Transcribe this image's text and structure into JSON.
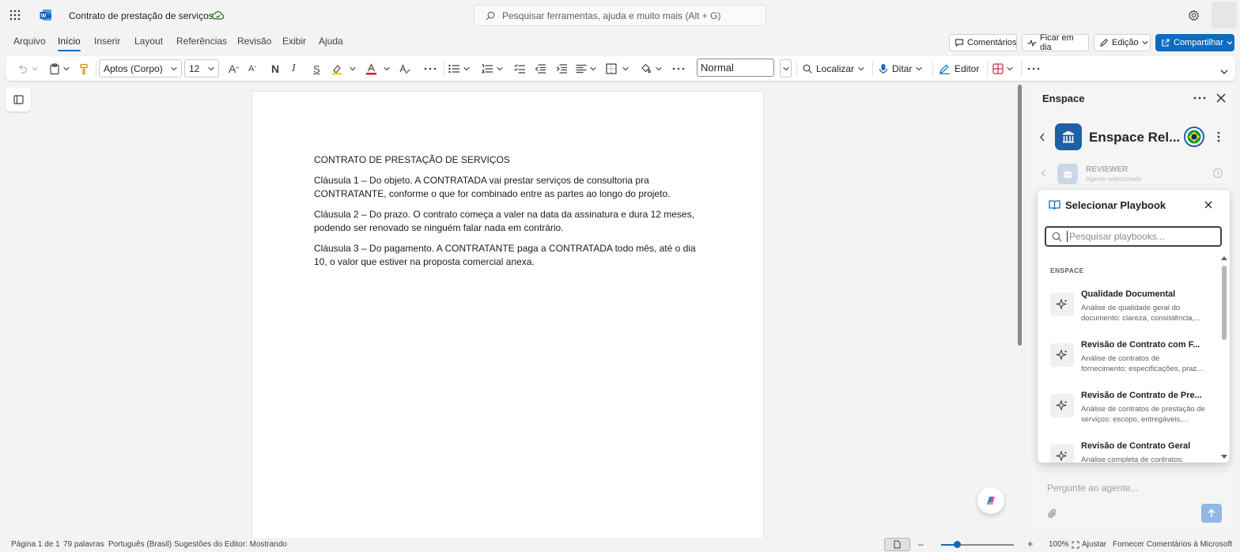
{
  "app": {
    "title": "Contrato de prestação de serviços",
    "search_placeholder": "Pesquisar ferramentas, ajuda e muito mais (Alt + G)"
  },
  "menu": {
    "items": [
      "Arquivo",
      "Início",
      "Inserir",
      "Layout",
      "Referências",
      "Revisão",
      "Exibir",
      "Ajuda"
    ],
    "active": "Início"
  },
  "top_actions": {
    "comments": "Comentários",
    "catch_up": "Ficar em dia",
    "editing": "Edição",
    "share": "Compartilhar"
  },
  "ribbon": {
    "font_name": "Aptos (Corpo)",
    "font_size": "12",
    "bold_label": "N",
    "italic_label": "I",
    "underline_label": "S",
    "style_value": "Normal",
    "find_label": "Localizar",
    "dictate_label": "Ditar",
    "editor_label": "Editor"
  },
  "document": {
    "title": "CONTRATO DE PRESTAÇÃO DE SERVIÇOS",
    "paragraphs": [
      "Cláusula 1 – Do objeto. A CONTRATADA vai prestar serviços de consultoria pra CONTRATANTE, conforme o que for combinado entre as partes ao longo do projeto.",
      "Cláusula 2 – Do prazo. O contrato começa a valer na data da assinatura e dura 12 meses, podendo ser renovado se ninguém falar nada em contrário.",
      "Cláusula 3 – Do pagamento. A CONTRATANTE paga a CONTRATADA todo mês, até o dia 10, o valor que estiver na proposta comercial anexa."
    ]
  },
  "pane": {
    "title": "Enspace",
    "workspace_name": "Enspace Rel...",
    "agent_label": "REVIEWER",
    "agent_sub": "Agente selecionado",
    "ask_placeholder": "Pergunte ao agente..."
  },
  "playbook_dialog": {
    "title": "Selecionar Playbook",
    "search_placeholder": "Pesquisar playbooks...",
    "section": "ENSPACE",
    "items": [
      {
        "title": "Qualidade Documental",
        "desc": "Análise de qualidade geral do documento: clareza, consistência,..."
      },
      {
        "title": "Revisão de Contrato com F...",
        "desc": "Análise de contratos de fornecimento: especificações, praz..."
      },
      {
        "title": "Revisão de Contrato de Pre...",
        "desc": "Análise de contratos de prestação de serviços: escopo, entregáveis,..."
      },
      {
        "title": "Revisão de Contrato Geral",
        "desc": "Análise completa de contratos:"
      }
    ]
  },
  "status": {
    "page": "Página 1 de 1",
    "words": "79 palavras",
    "language": "Português (Brasil)",
    "suggestions": "Sugestões do Editor: Mostrando",
    "zoom": "100%",
    "fit": "Ajustar",
    "feedback": "Fornecer Comentários à Microsoft"
  },
  "colors": {
    "accent": "#0f6cbd",
    "workspace_icon_bg": "#1f5fa6"
  }
}
